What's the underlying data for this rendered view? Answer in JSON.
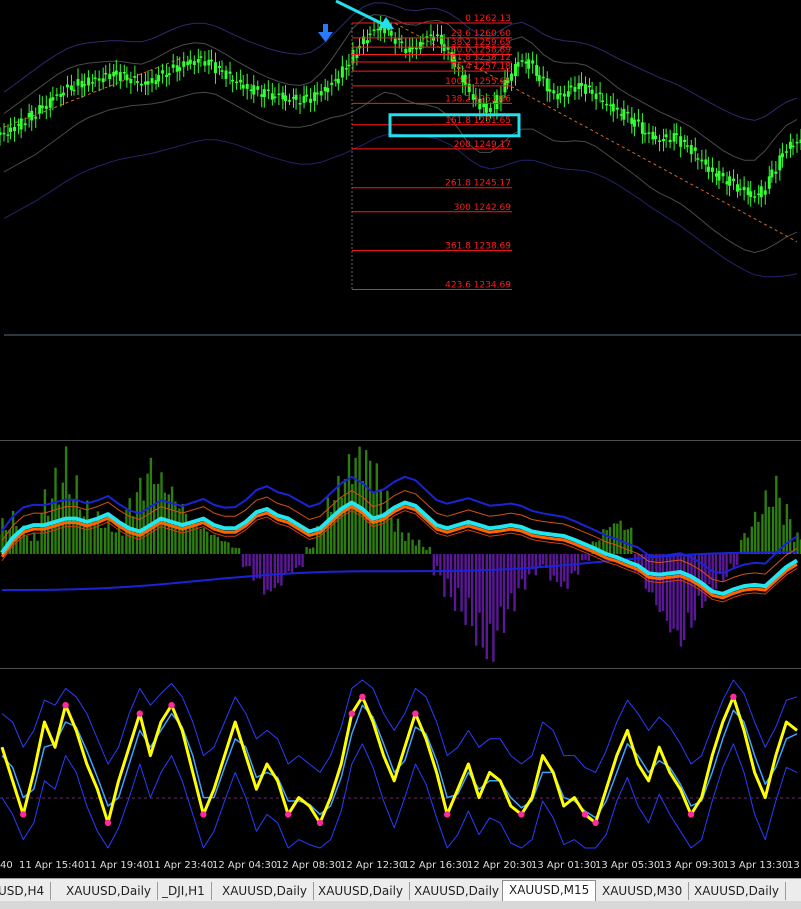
{
  "colors": {
    "background": "#000000",
    "candle": "#33ff33",
    "fib": "#ff1a1a",
    "highlight_box": "#22e0ee",
    "arrow": "#22e0ee",
    "down_arrow": "#2a79ff",
    "macd_pos": "#2d7d10",
    "macd_neg": "#5a1796",
    "cyan_line": "#22e6f0",
    "orange_line": "#ff6600",
    "blue_band": "#1a24d6",
    "stoch_main": "#ffff00",
    "stoch_dots": "#ff2aa0",
    "stoch_signal": "#3da2ff",
    "stoch_band": "#2a3cff"
  },
  "chart_data": [
    {
      "type": "line",
      "panel": "price",
      "symbol": "XAUUSD",
      "timeframe": "M15",
      "annotations": [
        "down-arrow-marker",
        "cyan-trend-arrow",
        "highlight-box-161.8"
      ],
      "close": [
        1250.8,
        1251.5,
        1252.4,
        1253.2,
        1254.1,
        1254.9,
        1255.6,
        1256.0,
        1256.3,
        1256.5,
        1256.8,
        1256.6,
        1256.2,
        1255.9,
        1256.4,
        1257.0,
        1257.6,
        1258.1,
        1258.4,
        1258.0,
        1257.2,
        1256.5,
        1255.9,
        1255.4,
        1255.0,
        1254.7,
        1254.5,
        1254.3,
        1254.2,
        1254.5,
        1255.2,
        1256.3,
        1257.8,
        1259.4,
        1260.8,
        1261.6,
        1261.2,
        1260.1,
        1259.2,
        1259.9,
        1261.0,
        1260.3,
        1258.6,
        1256.4,
        1254.3,
        1253.2,
        1253.6,
        1255.8,
        1257.7,
        1258.3,
        1257.1,
        1255.6,
        1254.6,
        1255.1,
        1255.6,
        1255.2,
        1254.4,
        1253.6,
        1252.9,
        1252.2,
        1251.2,
        1250.4,
        1250.1,
        1250.4,
        1249.6,
        1248.6,
        1247.5,
        1246.6,
        1246.0,
        1245.2,
        1244.6,
        1244.3,
        1245.9,
        1248.0,
        1249.6,
        1249.8
      ],
      "bb_upper": [
        1252.8,
        1253.6,
        1254.4,
        1255.2,
        1256.0,
        1256.8,
        1257.4,
        1257.8,
        1258.0,
        1258.1,
        1258.2,
        1258.2,
        1258.0,
        1257.9,
        1258.3,
        1258.9,
        1259.5,
        1259.9,
        1260.1,
        1260.0,
        1259.5,
        1258.9,
        1258.2,
        1257.6,
        1257.0,
        1256.5,
        1256.1,
        1255.8,
        1255.7,
        1256.0,
        1257.0,
        1258.4,
        1260.0,
        1261.6,
        1262.6,
        1263.0,
        1262.9,
        1262.5,
        1262.0,
        1261.9,
        1262.3,
        1262.4,
        1262.0,
        1261.0,
        1259.6,
        1258.4,
        1258.3,
        1259.5,
        1260.4,
        1260.7,
        1260.0,
        1258.9,
        1258.2,
        1258.0,
        1258.0,
        1257.8,
        1257.2,
        1256.4,
        1255.5,
        1254.8,
        1254.2,
        1253.6,
        1253.0,
        1252.5,
        1252.0,
        1251.4,
        1250.6,
        1249.8,
        1249.0,
        1248.4,
        1248.0,
        1248.0,
        1249.0,
        1250.4,
        1251.6,
        1252.2
      ],
      "bb_lower": [
        1246.8,
        1247.4,
        1248.0,
        1248.6,
        1249.4,
        1250.2,
        1251.0,
        1251.8,
        1252.4,
        1252.8,
        1253.2,
        1253.4,
        1253.6,
        1253.7,
        1253.8,
        1254.0,
        1254.3,
        1254.6,
        1254.9,
        1255.0,
        1254.8,
        1254.2,
        1253.6,
        1253.0,
        1252.4,
        1251.9,
        1251.6,
        1251.4,
        1251.4,
        1251.6,
        1252.0,
        1252.4,
        1252.6,
        1253.0,
        1253.6,
        1254.4,
        1255.0,
        1254.8,
        1254.2,
        1253.8,
        1253.7,
        1253.4,
        1252.6,
        1251.2,
        1249.6,
        1248.8,
        1248.8,
        1249.6,
        1250.6,
        1251.2,
        1251.2,
        1250.6,
        1250.0,
        1249.9,
        1250.0,
        1249.9,
        1249.4,
        1248.6,
        1247.8,
        1247.0,
        1246.2,
        1245.3,
        1244.6,
        1244.1,
        1243.5,
        1242.7,
        1241.8,
        1240.9,
        1240.1,
        1239.4,
        1238.8,
        1238.5,
        1238.8,
        1239.4,
        1240.1,
        1240.6
      ],
      "envelope_outer_upper": [
        1255.0,
        1255.8,
        1256.6,
        1257.4,
        1258.2,
        1258.9,
        1259.5,
        1259.9,
        1260.1,
        1260.2,
        1260.3,
        1260.3,
        1260.2,
        1260.2,
        1260.5,
        1261.0,
        1261.5,
        1261.9,
        1262.1,
        1262.1,
        1261.8,
        1261.3,
        1260.8,
        1260.3,
        1259.9,
        1259.5,
        1259.2,
        1259.0,
        1258.9,
        1259.1,
        1259.8,
        1260.8,
        1261.9,
        1263.0,
        1263.8,
        1264.2,
        1264.2,
        1263.9,
        1263.5,
        1263.4,
        1263.6,
        1263.6,
        1263.2,
        1262.5,
        1261.6,
        1260.9,
        1260.8,
        1261.4,
        1262.0,
        1262.2,
        1261.7,
        1261.0,
        1260.5,
        1260.3,
        1260.2,
        1260.0,
        1259.6,
        1259.1,
        1258.5,
        1258.0,
        1257.5,
        1257.0,
        1256.5,
        1256.1,
        1255.6,
        1255.0,
        1254.4,
        1253.8,
        1253.2,
        1252.7,
        1252.3,
        1252.1,
        1252.5,
        1253.3,
        1254.0,
        1254.4
      ],
      "envelope_outer_lower": [
        1242.0,
        1242.6,
        1243.2,
        1243.8,
        1244.5,
        1245.2,
        1245.9,
        1246.5,
        1247.0,
        1247.4,
        1247.8,
        1248.1,
        1248.3,
        1248.5,
        1248.7,
        1249.0,
        1249.3,
        1249.6,
        1249.9,
        1250.1,
        1250.1,
        1249.9,
        1249.6,
        1249.2,
        1248.8,
        1248.4,
        1248.1,
        1247.8,
        1247.6,
        1247.6,
        1247.8,
        1248.2,
        1248.6,
        1249.1,
        1249.6,
        1250.2,
        1250.6,
        1250.7,
        1250.6,
        1250.5,
        1250.4,
        1250.2,
        1249.7,
        1249.0,
        1248.1,
        1247.4,
        1247.1,
        1247.3,
        1247.7,
        1248.0,
        1248.0,
        1247.7,
        1247.3,
        1247.1,
        1247.0,
        1246.9,
        1246.6,
        1246.1,
        1245.5,
        1244.8,
        1244.1,
        1243.3,
        1242.6,
        1241.9,
        1241.2,
        1240.4,
        1239.6,
        1238.8,
        1238.0,
        1237.3,
        1236.7,
        1236.2,
        1236.0,
        1236.0,
        1236.1,
        1236.3
      ],
      "trend_line_1": {
        "from": [
          0,
          1251.4
        ],
        "to": [
          17,
          1258.6
        ]
      },
      "trend_line_2": {
        "from": [
          37,
          1262.1
        ],
        "to": [
          75,
          1239.6
        ]
      },
      "ylim": [
        1230,
        1264.5
      ]
    },
    {
      "type": "line",
      "panel": "fibonacci",
      "levels": [
        {
          "ratio": "0",
          "price": "1262.13",
          "value": 1262.13
        },
        {
          "ratio": "23.6",
          "price": "1260.60",
          "value": 1260.6
        },
        {
          "ratio": "38.2",
          "price": "1259.65",
          "value": 1259.65
        },
        {
          "ratio": "50.0",
          "price": "1258.89",
          "value": 1258.89
        },
        {
          "ratio": "61.8",
          "price": "1258.12",
          "value": 1258.12
        },
        {
          "ratio": "76.4",
          "price": "1257.18",
          "value": 1257.18
        },
        {
          "ratio": "100.0",
          "price": "1255.65",
          "value": 1255.65
        },
        {
          "ratio": "138.2",
          "price": "1253.86",
          "value": 1253.86
        },
        {
          "ratio": "161.8",
          "price": "1251.65",
          "value": 1251.65
        },
        {
          "ratio": "200",
          "price": "1249.17",
          "value": 1249.17
        },
        {
          "ratio": "261.8",
          "price": "1245.17",
          "value": 1245.17
        },
        {
          "ratio": "300",
          "price": "1242.69",
          "value": 1242.69
        },
        {
          "ratio": "361.8",
          "price": "1238.69",
          "value": 1238.69
        },
        {
          "ratio": "423.6",
          "price": "1234.69",
          "value": 1234.69
        }
      ]
    },
    {
      "type": "bar",
      "panel": "macd",
      "values": [
        10,
        12,
        8,
        6,
        18,
        24,
        30,
        22,
        15,
        12,
        10,
        8,
        16,
        22,
        28,
        24,
        20,
        15,
        10,
        8,
        6,
        4,
        2,
        -4,
        -8,
        -12,
        -10,
        -6,
        -4,
        2,
        8,
        16,
        22,
        28,
        30,
        26,
        18,
        10,
        6,
        4,
        2,
        -6,
        -12,
        -16,
        -20,
        -26,
        -30,
        -22,
        -16,
        -10,
        -6,
        -4,
        -8,
        -10,
        -6,
        -2,
        4,
        8,
        10,
        8,
        -6,
        -12,
        -18,
        -24,
        -28,
        -22,
        -16,
        -12,
        -8,
        -4,
        6,
        12,
        18,
        22,
        14,
        6
      ],
      "cyan_line": [
        0.02,
        0.25,
        0.4,
        0.45,
        0.45,
        0.5,
        0.55,
        0.55,
        0.5,
        0.55,
        0.62,
        0.5,
        0.4,
        0.35,
        0.45,
        0.55,
        0.5,
        0.45,
        0.5,
        0.55,
        0.45,
        0.4,
        0.4,
        0.5,
        0.65,
        0.7,
        0.6,
        0.55,
        0.45,
        0.35,
        0.4,
        0.55,
        0.7,
        0.8,
        0.7,
        0.55,
        0.6,
        0.72,
        0.8,
        0.75,
        0.6,
        0.45,
        0.4,
        0.45,
        0.5,
        0.45,
        0.4,
        0.42,
        0.45,
        0.42,
        0.35,
        0.32,
        0.3,
        0.28,
        0.22,
        0.15,
        0.08,
        0.0,
        -0.05,
        -0.12,
        -0.18,
        -0.3,
        -0.32,
        -0.3,
        -0.28,
        -0.35,
        -0.45,
        -0.58,
        -0.62,
        -0.55,
        -0.5,
        -0.48,
        -0.5,
        -0.35,
        -0.2,
        -0.1
      ],
      "ylim": [
        -1.4,
        1.4
      ]
    },
    {
      "type": "line",
      "panel": "stochastic",
      "main": [
        60,
        40,
        20,
        45,
        75,
        60,
        85,
        70,
        50,
        35,
        15,
        40,
        60,
        80,
        55,
        75,
        85,
        70,
        45,
        20,
        35,
        55,
        75,
        55,
        35,
        50,
        40,
        20,
        30,
        25,
        15,
        30,
        50,
        80,
        90,
        75,
        55,
        40,
        60,
        80,
        65,
        45,
        20,
        35,
        50,
        30,
        45,
        40,
        25,
        20,
        30,
        55,
        45,
        25,
        30,
        20,
        15,
        35,
        55,
        70,
        50,
        40,
        60,
        45,
        35,
        20,
        30,
        55,
        75,
        90,
        70,
        45,
        30,
        55,
        75,
        70
      ],
      "signal": [
        55,
        48,
        30,
        35,
        60,
        62,
        75,
        72,
        58,
        42,
        25,
        30,
        50,
        70,
        60,
        70,
        80,
        72,
        55,
        30,
        30,
        48,
        65,
        60,
        42,
        45,
        42,
        28,
        28,
        26,
        20,
        25,
        42,
        68,
        85,
        78,
        62,
        45,
        52,
        72,
        68,
        52,
        30,
        32,
        45,
        35,
        40,
        40,
        30,
        24,
        28,
        45,
        45,
        30,
        28,
        22,
        18,
        28,
        45,
        62,
        55,
        45,
        52,
        48,
        38,
        25,
        28,
        45,
        65,
        82,
        75,
        55,
        38,
        48,
        65,
        68
      ],
      "band_high": [
        80,
        75,
        60,
        70,
        88,
        85,
        95,
        90,
        80,
        65,
        50,
        60,
        80,
        95,
        85,
        92,
        98,
        90,
        75,
        55,
        60,
        75,
        90,
        80,
        65,
        70,
        65,
        50,
        55,
        50,
        45,
        55,
        72,
        95,
        100,
        95,
        80,
        70,
        80,
        95,
        90,
        75,
        55,
        60,
        70,
        60,
        65,
        65,
        55,
        50,
        55,
        75,
        70,
        55,
        55,
        48,
        45,
        58,
        75,
        88,
        80,
        70,
        78,
        72,
        62,
        50,
        55,
        72,
        88,
        100,
        92,
        75,
        60,
        72,
        88,
        90
      ],
      "band_low": [
        30,
        20,
        5,
        15,
        40,
        35,
        55,
        45,
        25,
        10,
        0,
        12,
        30,
        50,
        30,
        45,
        55,
        40,
        20,
        0,
        10,
        28,
        45,
        30,
        10,
        20,
        15,
        0,
        5,
        2,
        0,
        5,
        22,
        50,
        62,
        48,
        28,
        12,
        30,
        50,
        38,
        18,
        0,
        8,
        22,
        8,
        18,
        15,
        3,
        0,
        5,
        28,
        18,
        2,
        5,
        0,
        0,
        8,
        28,
        42,
        25,
        15,
        32,
        20,
        10,
        0,
        5,
        28,
        48,
        62,
        45,
        20,
        5,
        28,
        48,
        45
      ],
      "ylim": [
        0,
        100
      ]
    }
  ],
  "xaxis": {
    "ticks": [
      "40",
      "11 Apr 15:40",
      "11 Apr 19:40",
      "11 Apr 23:40",
      "12 Apr 04:30",
      "12 Apr 08:30",
      "12 Apr 12:30",
      "12 Apr 16:30",
      "12 Apr 20:30",
      "13 Apr 01:30",
      "13 Apr 05:30",
      "13 Apr 09:30",
      "13 Apr 13:30",
      "13"
    ]
  },
  "tabs": [
    {
      "label": "USD,H4"
    },
    {
      "label": "XAUUSD,Daily"
    },
    {
      "label": "_DJI,H1"
    },
    {
      "label": "XAUUSD,Daily"
    },
    {
      "label": "XAUUSD,Daily"
    },
    {
      "label": "XAUUSD,Daily"
    },
    {
      "label": "XAUUSD,M15"
    },
    {
      "label": "XAUUSD,M30"
    },
    {
      "label": "XAUUSD,Daily"
    }
  ],
  "active_tab": 6
}
